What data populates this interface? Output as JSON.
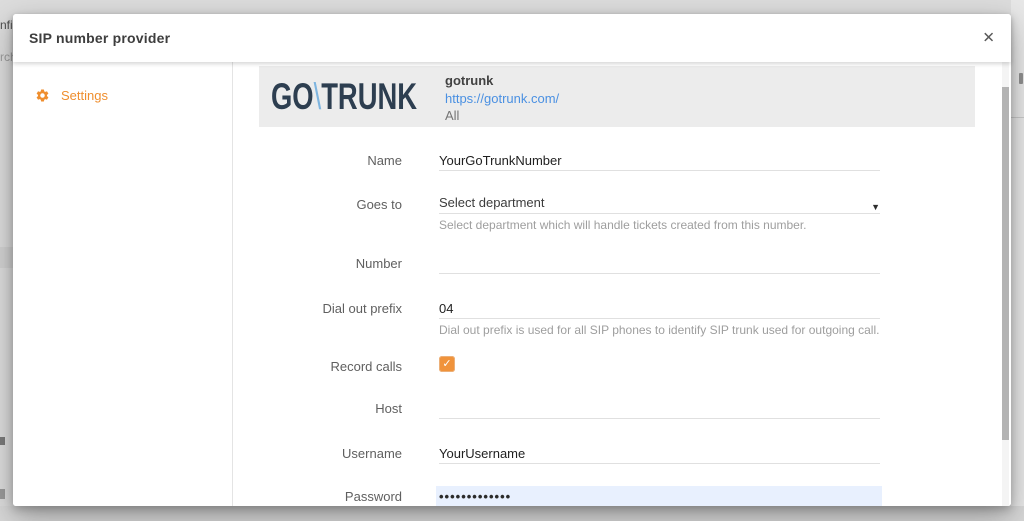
{
  "window": {
    "title": "SIP number provider"
  },
  "icons": {
    "close": "✕",
    "dropdown_arrow": "▼",
    "checkbox_check": "✓",
    "settings": "gear"
  },
  "sidebar": {
    "items": [
      {
        "label": "Settings",
        "icon": "gear-icon",
        "active": true
      }
    ]
  },
  "provider": {
    "logo": {
      "go": "GO",
      "slash": "\\",
      "trunk": "TRUNK"
    },
    "name": "gotrunk",
    "url": "https://gotrunk.com/",
    "scope": "All"
  },
  "form": {
    "fields": [
      {
        "label": "Name",
        "value": "YourGoTrunkNumber",
        "type": "text"
      },
      {
        "label": "Goes to",
        "value": "Select department",
        "type": "select",
        "helper": "Select department which will handle tickets created from this number."
      },
      {
        "label": "Number",
        "value": "",
        "type": "text"
      },
      {
        "label": "Dial out prefix",
        "value": "04",
        "type": "text",
        "helper": "Dial out prefix is used for all SIP phones to identify SIP trunk used for outgoing call."
      },
      {
        "label": "Record calls",
        "type": "checkbox",
        "checked": true
      },
      {
        "label": "Host",
        "value": "",
        "type": "text"
      },
      {
        "label": "Username",
        "value": "YourUsername",
        "type": "text"
      },
      {
        "label": "Password",
        "value": "•••••••••••••",
        "type": "password",
        "autofilled": true
      }
    ]
  },
  "background": {
    "fragments": [
      "nfig",
      "rch"
    ]
  },
  "colors": {
    "accent_orange": "#EF8E2E",
    "link_blue": "#4A90E2",
    "logo_navy": "#2D3E50",
    "logo_slash_blue": "#7EB5E0",
    "autofill_bg": "#E8F0FE",
    "band_gray": "#ECECEC"
  }
}
